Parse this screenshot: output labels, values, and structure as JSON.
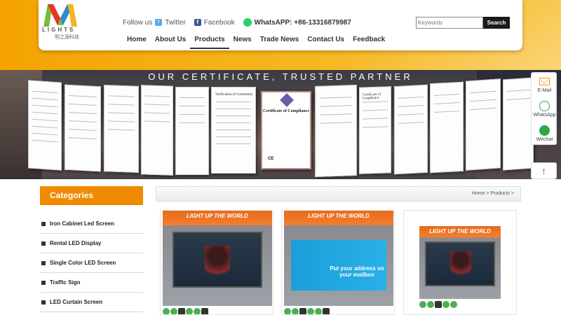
{
  "brand": {
    "name": "LIGHTS",
    "subtitle": "明之源科技"
  },
  "header": {
    "follow_label": "Follow us",
    "twitter_label": "Twitter",
    "facebook_label": "Facebook",
    "whatsapp_label": "WhatsAPP: +86-13316879987",
    "search_placeholder": "Keywords",
    "search_button": "Search"
  },
  "nav": {
    "items": [
      "Home",
      "About Us",
      "Products",
      "News",
      "Trade News",
      "Contact Us",
      "Feedback"
    ],
    "active": "Products"
  },
  "banner": {
    "title": "OUR CERTIFICATE, TRUSTED PARTNER",
    "center_certificate_title": "Certificate of Compliance",
    "left_certificate_title": "Verification of Conformity",
    "right_certificate_title": "Certificate of Compliance",
    "ce_mark": "CE"
  },
  "float_bar": {
    "email_label": "E-Mail",
    "whatsapp_label": "WhatsApp",
    "wechat_label": "Wechat",
    "top_arrow": "↑"
  },
  "sidebar": {
    "heading": "Categories",
    "items": [
      "Iron Cabinet Led Screen",
      "Rental LED Display",
      "Single Color LED Screen",
      "Traffic Sign",
      "LED Curtain Screen"
    ]
  },
  "breadcrumb": {
    "text": "Home > Products >"
  },
  "products": [
    {
      "banner_text": "LIGHT UP THE WORLD",
      "screen_text": ""
    },
    {
      "banner_text": "LIGHT UP THE WORLD",
      "screen_text": "Put your address on your mailbox"
    },
    {
      "banner_text": "LIGHT UP THE WORLD",
      "screen_text": ""
    }
  ],
  "colors": {
    "accent": "#f08a00",
    "band": "#f4a300",
    "dark": "#1a1a1a",
    "whatsapp": "#25d366"
  }
}
